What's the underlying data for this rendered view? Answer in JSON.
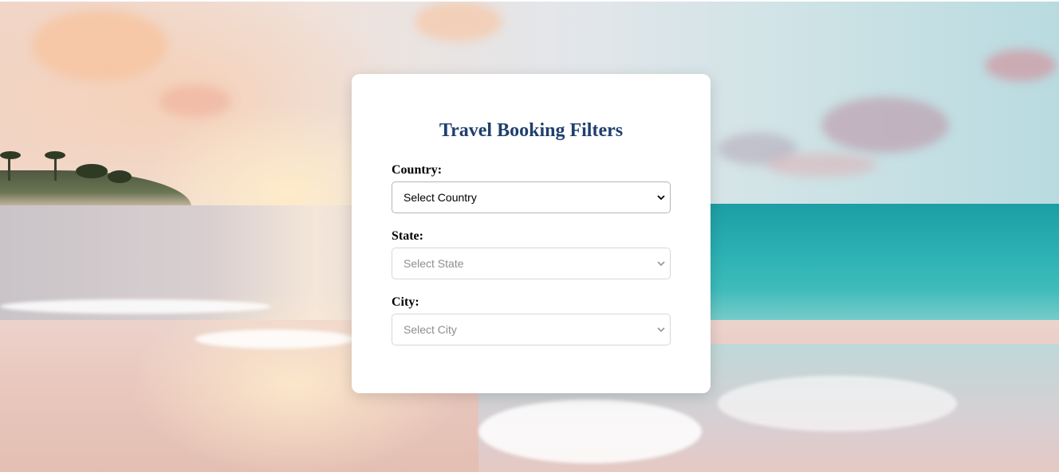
{
  "form": {
    "title": "Travel Booking Filters",
    "fields": [
      {
        "label": "Country:",
        "selected": "Select Country",
        "enabled": true
      },
      {
        "label": "State:",
        "selected": "Select State",
        "enabled": false
      },
      {
        "label": "City:",
        "selected": "Select City",
        "enabled": false
      }
    ]
  },
  "colors": {
    "title": "#1f3f6e",
    "card": "#ffffff",
    "disabled_text": "#8e8e8e"
  },
  "icons": {
    "select_arrow": "chevron-down-icon"
  }
}
